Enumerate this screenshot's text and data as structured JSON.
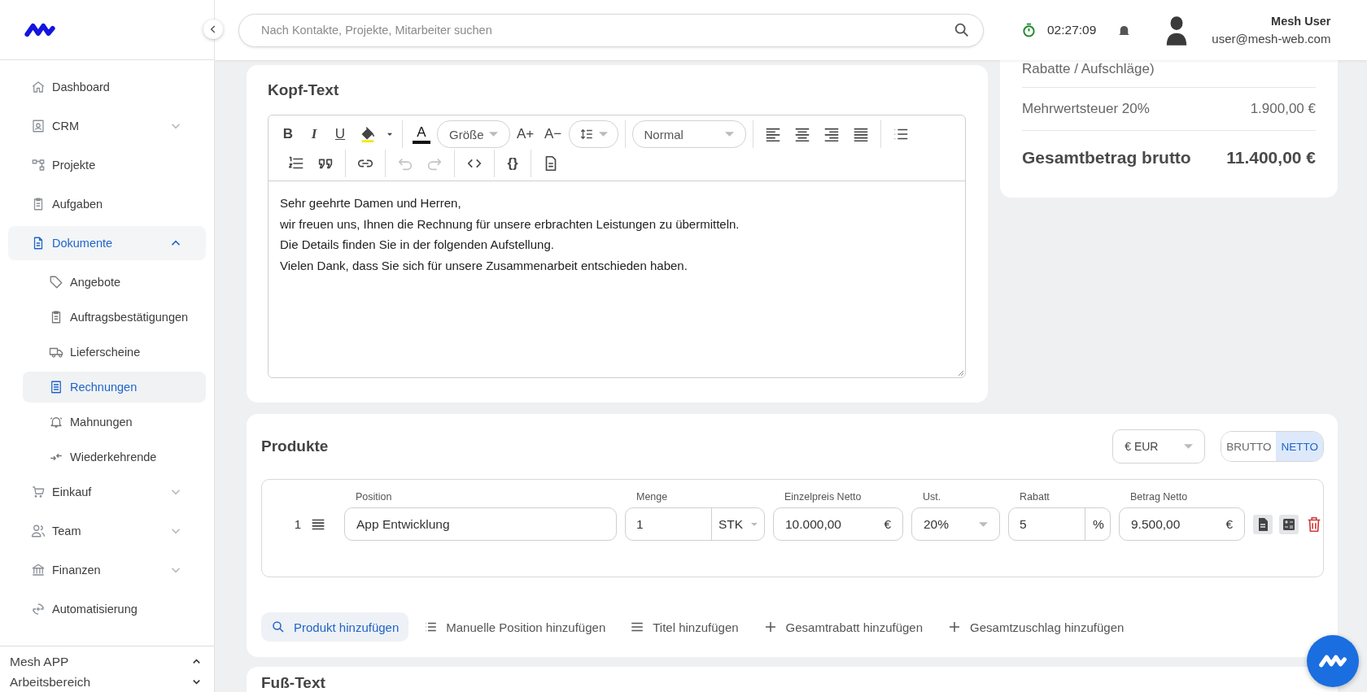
{
  "sidebar": {
    "items": [
      {
        "label": "Dashboard",
        "kind": "link",
        "selected": false
      },
      {
        "label": "CRM",
        "kind": "group",
        "selected": false,
        "expanded": false
      },
      {
        "label": "Projekte",
        "kind": "link",
        "selected": false
      },
      {
        "label": "Aufgaben",
        "kind": "link",
        "selected": false
      },
      {
        "label": "Dokumente",
        "kind": "group",
        "selected": true,
        "expanded": true,
        "children": [
          {
            "label": "Angebote",
            "selected": false
          },
          {
            "label": "Auftragsbestätigungen",
            "selected": false
          },
          {
            "label": "Lieferscheine",
            "selected": false
          },
          {
            "label": "Rechnungen",
            "selected": true
          },
          {
            "label": "Mahnungen",
            "selected": false
          },
          {
            "label": "Wiederkehrende",
            "selected": false
          }
        ]
      },
      {
        "label": "Einkauf",
        "kind": "group",
        "selected": false,
        "expanded": false
      },
      {
        "label": "Team",
        "kind": "group",
        "selected": false,
        "expanded": false
      },
      {
        "label": "Finanzen",
        "kind": "group",
        "selected": false,
        "expanded": false
      },
      {
        "label": "Automatisierung",
        "kind": "link",
        "selected": false
      }
    ],
    "footer": [
      {
        "label": "Mesh APP",
        "expanded": true
      },
      {
        "label": "Arbeitsbereich",
        "expanded": false
      }
    ]
  },
  "header": {
    "search": {
      "placeholder": "Nach Kontakte, Projekte, Mitarbeiter suchen"
    },
    "timer": "02:27:09",
    "user": {
      "name": "Mesh User",
      "email": "user@mesh-web.com"
    }
  },
  "head_text": {
    "title": "Kopf-Text",
    "toolbar": [
      [
        {
          "kind": "glyph",
          "label": "B",
          "disabled": false
        },
        {
          "kind": "glyph",
          "label": "I",
          "disabled": false
        },
        {
          "kind": "glyph",
          "label": "U",
          "disabled": false
        },
        {
          "kind": "icon",
          "disabled": false
        },
        {
          "kind": "icon",
          "disabled": false
        }
      ],
      [
        {
          "kind": "glyph",
          "label": "A",
          "disabled": false
        },
        {
          "kind": "select",
          "label": "Größe",
          "disabled": false
        },
        {
          "kind": "glyph",
          "label": "A+",
          "disabled": false
        },
        {
          "kind": "glyph",
          "label": "A−",
          "disabled": false
        },
        {
          "kind": "iconselect",
          "disabled": false
        }
      ],
      [
        {
          "kind": "select",
          "label": "Normal",
          "disabled": false
        }
      ],
      [
        {
          "kind": "icon",
          "disabled": false
        },
        {
          "kind": "icon",
          "disabled": false
        },
        {
          "kind": "icon",
          "disabled": false
        },
        {
          "kind": "icon",
          "disabled": false
        }
      ],
      [
        {
          "kind": "icon",
          "disabled": false
        }
      ],
      [
        {
          "kind": "icon",
          "disabled": false
        },
        {
          "kind": "icon",
          "disabled": false
        }
      ],
      [
        {
          "kind": "icon",
          "disabled": false
        }
      ],
      [
        {
          "kind": "icon",
          "disabled": true
        },
        {
          "kind": "icon",
          "disabled": true
        }
      ],
      [
        {
          "kind": "icon",
          "disabled": false
        }
      ],
      [
        {
          "kind": "glyph",
          "label": "{}",
          "disabled": false
        }
      ],
      [
        {
          "kind": "icon",
          "disabled": false
        }
      ]
    ],
    "paragraphs": [
      "Sehr geehrte Damen und Herren,",
      "wir freuen uns, Ihnen die Rechnung für unsere erbrachten Leistungen zu übermitteln.",
      "Die Details finden Sie in der folgenden Aufstellung.",
      "Vielen Dank, dass Sie sich für unsere Zusammenarbeit entschieden haben."
    ]
  },
  "totals": [
    {
      "kind": "line",
      "label": "Rabatte / Aufschläge)"
    },
    {
      "kind": "line",
      "label": "Mehrwertsteuer 20%",
      "value": "1.900,00 €"
    },
    {
      "kind": "total",
      "label": "Gesamtbetrag brutto",
      "value": "11.400,00 €"
    }
  ],
  "products": {
    "title": "Produkte",
    "currency": "€ EUR",
    "price_mode": [
      {
        "label": "BRUTTO",
        "selected": false
      },
      {
        "label": "NETTO",
        "selected": true
      }
    ],
    "columns": [
      "Position",
      "Menge",
      "Einzelpreis Netto",
      "Ust.",
      "Rabatt",
      "Betrag Netto"
    ],
    "rows": [
      {
        "number": "1",
        "position": "App Entwicklung",
        "quantity": "1",
        "unit": "STK",
        "unit_price": "10.000,00",
        "unit_price_currency": "€",
        "tax": "20%",
        "discount": "5",
        "discount_unit": "%",
        "amount": "9.500,00",
        "amount_currency": "€"
      }
    ],
    "actions": [
      {
        "label": "Produkt hinzufügen",
        "selected": true
      },
      {
        "label": "Manuelle Position hinzufügen",
        "selected": false
      },
      {
        "label": "Titel hinzufügen",
        "selected": false
      },
      {
        "label": "Gesamtrabatt hinzufügen",
        "selected": false
      },
      {
        "label": "Gesamtzuschlag hinzufügen",
        "selected": false
      }
    ]
  },
  "foot_text": {
    "title": "Fuß-Text"
  }
}
